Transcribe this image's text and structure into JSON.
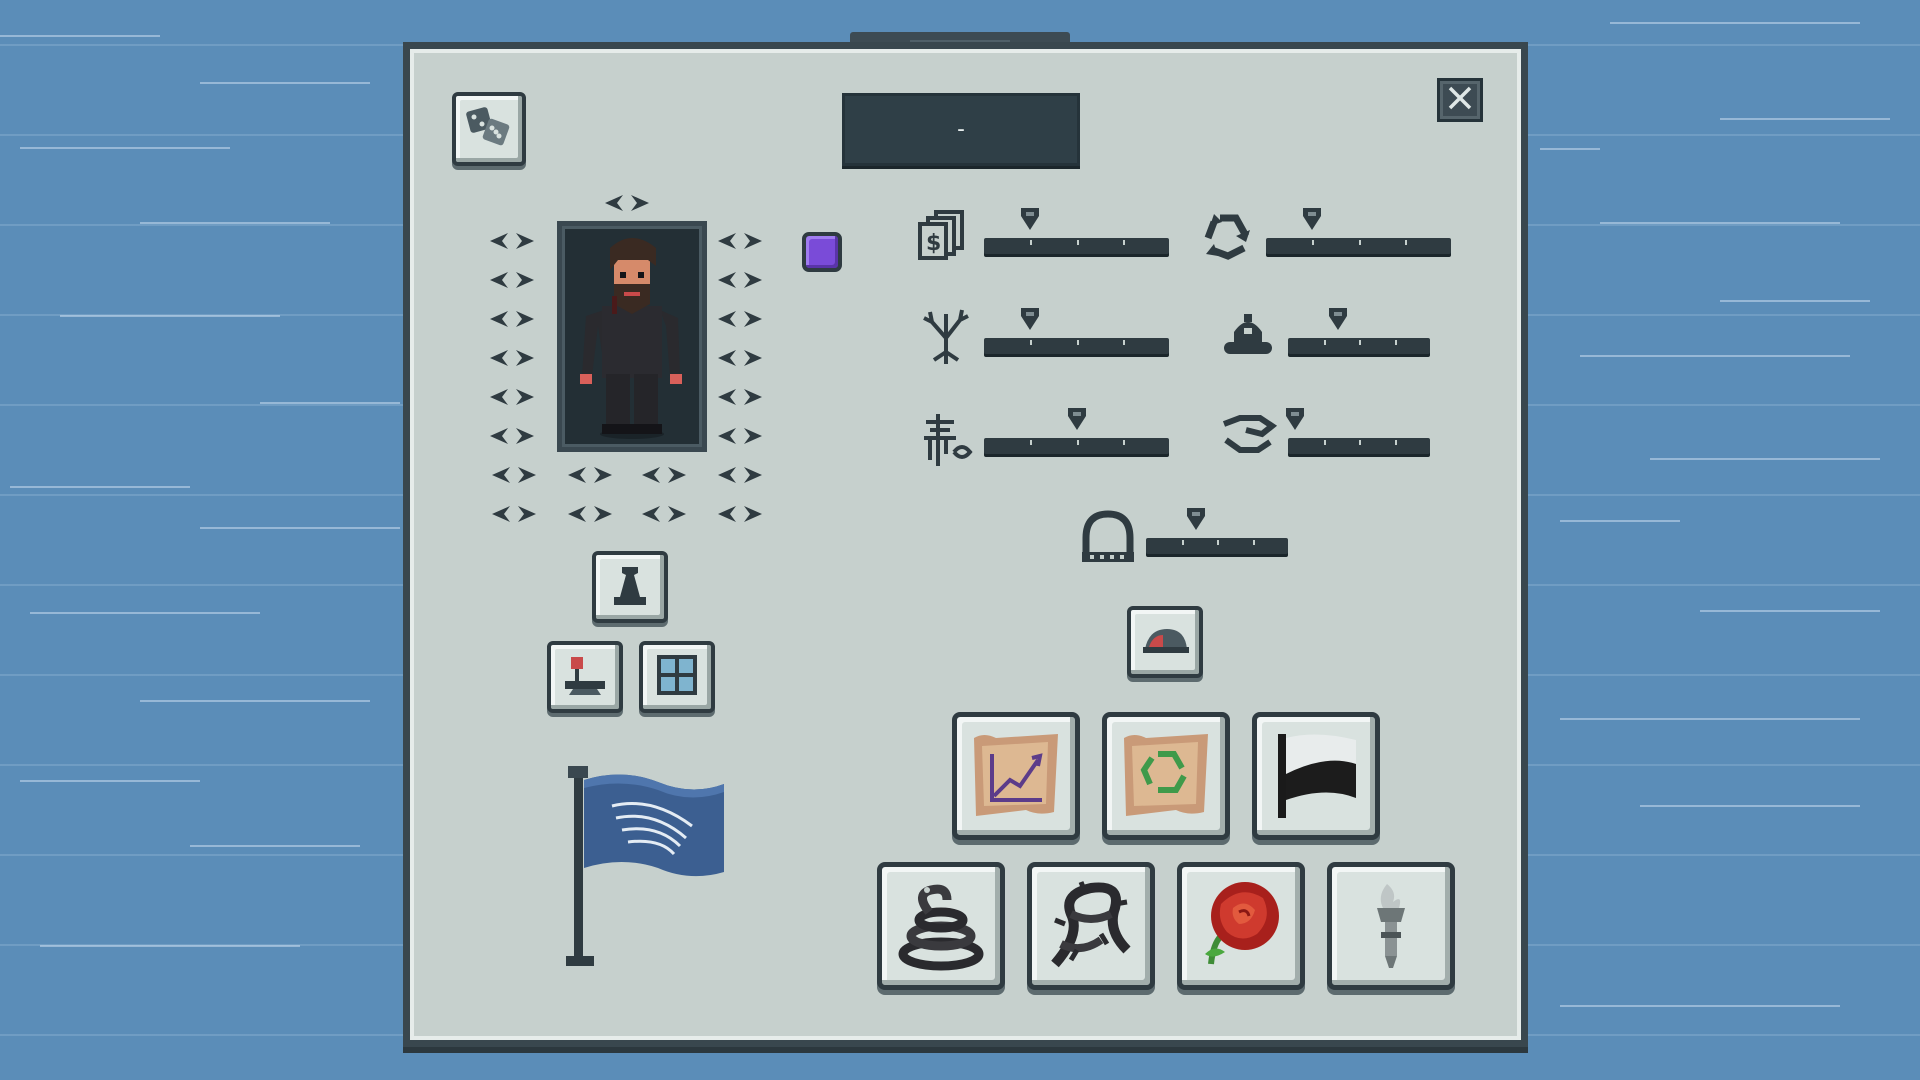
{
  "character": {
    "name_display": "-",
    "color_swatch": "#7a4bd8"
  },
  "stats": [
    {
      "id": "money",
      "icon": "money-stack-icon",
      "value": 0.25
    },
    {
      "id": "recycle",
      "icon": "recycle-icon",
      "value": 0.25
    },
    {
      "id": "nature",
      "icon": "dead-tree-icon",
      "value": 0.25
    },
    {
      "id": "authority",
      "icon": "bell-helmet-icon",
      "value": 0.35
    },
    {
      "id": "culture",
      "icon": "pagoda-icon",
      "value": 0.5
    },
    {
      "id": "cooperation",
      "icon": "handshake-icon",
      "value": 0.05
    },
    {
      "id": "infrastructure",
      "icon": "arch-bridge-icon",
      "value": 0.35
    }
  ],
  "colors": {
    "panel": "#c6d0cd",
    "panel_border": "#39474e",
    "background": "#5b8db8",
    "flag": "#3c5f91"
  },
  "items": [
    {
      "id": "chart-scroll",
      "icon": "growth-chart-parchment-icon"
    },
    {
      "id": "recycle-scroll",
      "icon": "recycle-parchment-icon"
    },
    {
      "id": "black-white-flag",
      "icon": "black-white-flag-icon"
    },
    {
      "id": "coiled-snake",
      "icon": "coiled-snake-icon"
    },
    {
      "id": "thorny-branch",
      "icon": "thorny-branch-icon"
    },
    {
      "id": "red-rose",
      "icon": "red-rose-icon"
    },
    {
      "id": "torch",
      "icon": "torch-icon"
    }
  ]
}
